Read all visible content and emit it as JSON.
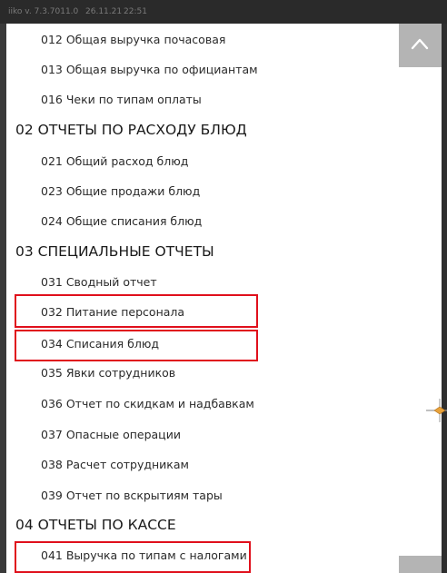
{
  "status": {
    "app": "iiko v. 7.3.7011.0",
    "date": "26.11.21",
    "time": "22:51"
  },
  "sections": [
    {
      "title": "",
      "items": [
        {
          "label": "012 Общая выручка почасовая"
        },
        {
          "label": "013 Общая выручка по официантам"
        },
        {
          "label": "016 Чеки по типам оплаты"
        }
      ]
    },
    {
      "title": "02 ОТЧЕТЫ ПО РАСХОДУ БЛЮД",
      "items": [
        {
          "label": "021 Общий расход блюд"
        },
        {
          "label": "023 Общие продажи блюд"
        },
        {
          "label": "024 Общие списания блюд"
        }
      ]
    },
    {
      "title": "03 СПЕЦИАЛЬНЫЕ ОТЧЕТЫ",
      "items": [
        {
          "label": "031 Сводный отчет"
        },
        {
          "label": "032 Питание персонала",
          "highlighted": true
        },
        {
          "label": "034 Списания блюд",
          "highlighted": true
        },
        {
          "label": "035 Явки сотрудников"
        },
        {
          "label": "036 Отчет по скидкам и надбавкам"
        },
        {
          "label": "037 Опасные операции"
        },
        {
          "label": "038 Расчет сотрудникам"
        },
        {
          "label": "039 Отчет по вскрытиям тары"
        }
      ]
    },
    {
      "title": "04 ОТЧЕТЫ ПО КАССЕ",
      "items": [
        {
          "label": "041 Выручка по типам с налогами",
          "highlighted": true
        }
      ]
    }
  ],
  "icons": {
    "scroll_top": "chevron-up-icon",
    "edge_handle": "drag-handle-icon"
  },
  "colors": {
    "highlight": "#e0101c",
    "scroll_button": "#b4b4b4",
    "background": "#2b2b2b"
  }
}
